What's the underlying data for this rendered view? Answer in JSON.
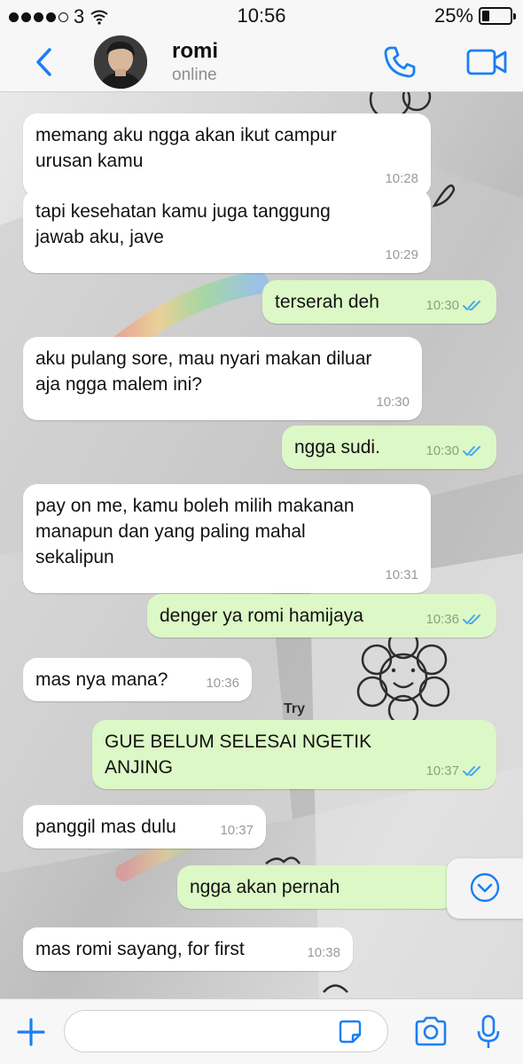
{
  "status_bar": {
    "carrier": "3",
    "time": "10:56",
    "battery": "25%",
    "signal_bars": 4,
    "signal_total": 5
  },
  "header": {
    "contact_name": "romi",
    "contact_status": "online"
  },
  "colors": {
    "accent": "#1a7ff5",
    "outgoing_bubble": "#dcf8c6",
    "incoming_bubble": "#ffffff",
    "read_ticks": "#4aa8ee"
  },
  "messages": [
    {
      "direction": "in",
      "lines": [
        "memang aku ngga akan ikut campur",
        "urusan kamu"
      ],
      "time": "10:28"
    },
    {
      "direction": "in",
      "lines": [
        "tapi kesehatan kamu juga tanggung",
        "jawab aku, jave"
      ],
      "time": "10:29"
    },
    {
      "direction": "out",
      "lines": [
        "terserah deh"
      ],
      "time": "10:30",
      "read": true
    },
    {
      "direction": "in",
      "lines": [
        "aku pulang sore, mau nyari makan diluar",
        "aja ngga malem ini?"
      ],
      "time": "10:30"
    },
    {
      "direction": "out",
      "lines": [
        "ngga sudi."
      ],
      "time": "10:30",
      "read": true
    },
    {
      "direction": "in",
      "lines": [
        "pay on me, kamu boleh milih makanan",
        "manapun dan yang paling mahal",
        "sekalipun"
      ],
      "time": "10:31"
    },
    {
      "direction": "out",
      "lines": [
        "denger ya romi hamijaya"
      ],
      "time": "10:36",
      "read": true
    },
    {
      "direction": "in",
      "lines": [
        "mas nya mana?"
      ],
      "time": "10:36"
    },
    {
      "direction": "out",
      "lines": [
        "GUE BELUM SELESAI NGETIK ANJING"
      ],
      "time": "10:37",
      "read": true
    },
    {
      "direction": "in",
      "lines": [
        "panggil mas dulu"
      ],
      "time": "10:37"
    },
    {
      "direction": "out",
      "lines": [
        "ngga akan pernah"
      ],
      "time": "",
      "read": false
    },
    {
      "direction": "in",
      "lines": [
        "mas romi sayang, for first"
      ],
      "time": "10:38"
    }
  ],
  "background_doodle_text": "Try",
  "icons": {
    "back": "chevron-left-icon",
    "call": "phone-icon",
    "video": "video-camera-icon",
    "scroll": "chevron-down-icon",
    "plus": "plus-icon",
    "sticker": "sticker-icon",
    "camera": "camera-icon",
    "mic": "microphone-icon",
    "read": "double-check-icon"
  },
  "input": {
    "value": ""
  }
}
